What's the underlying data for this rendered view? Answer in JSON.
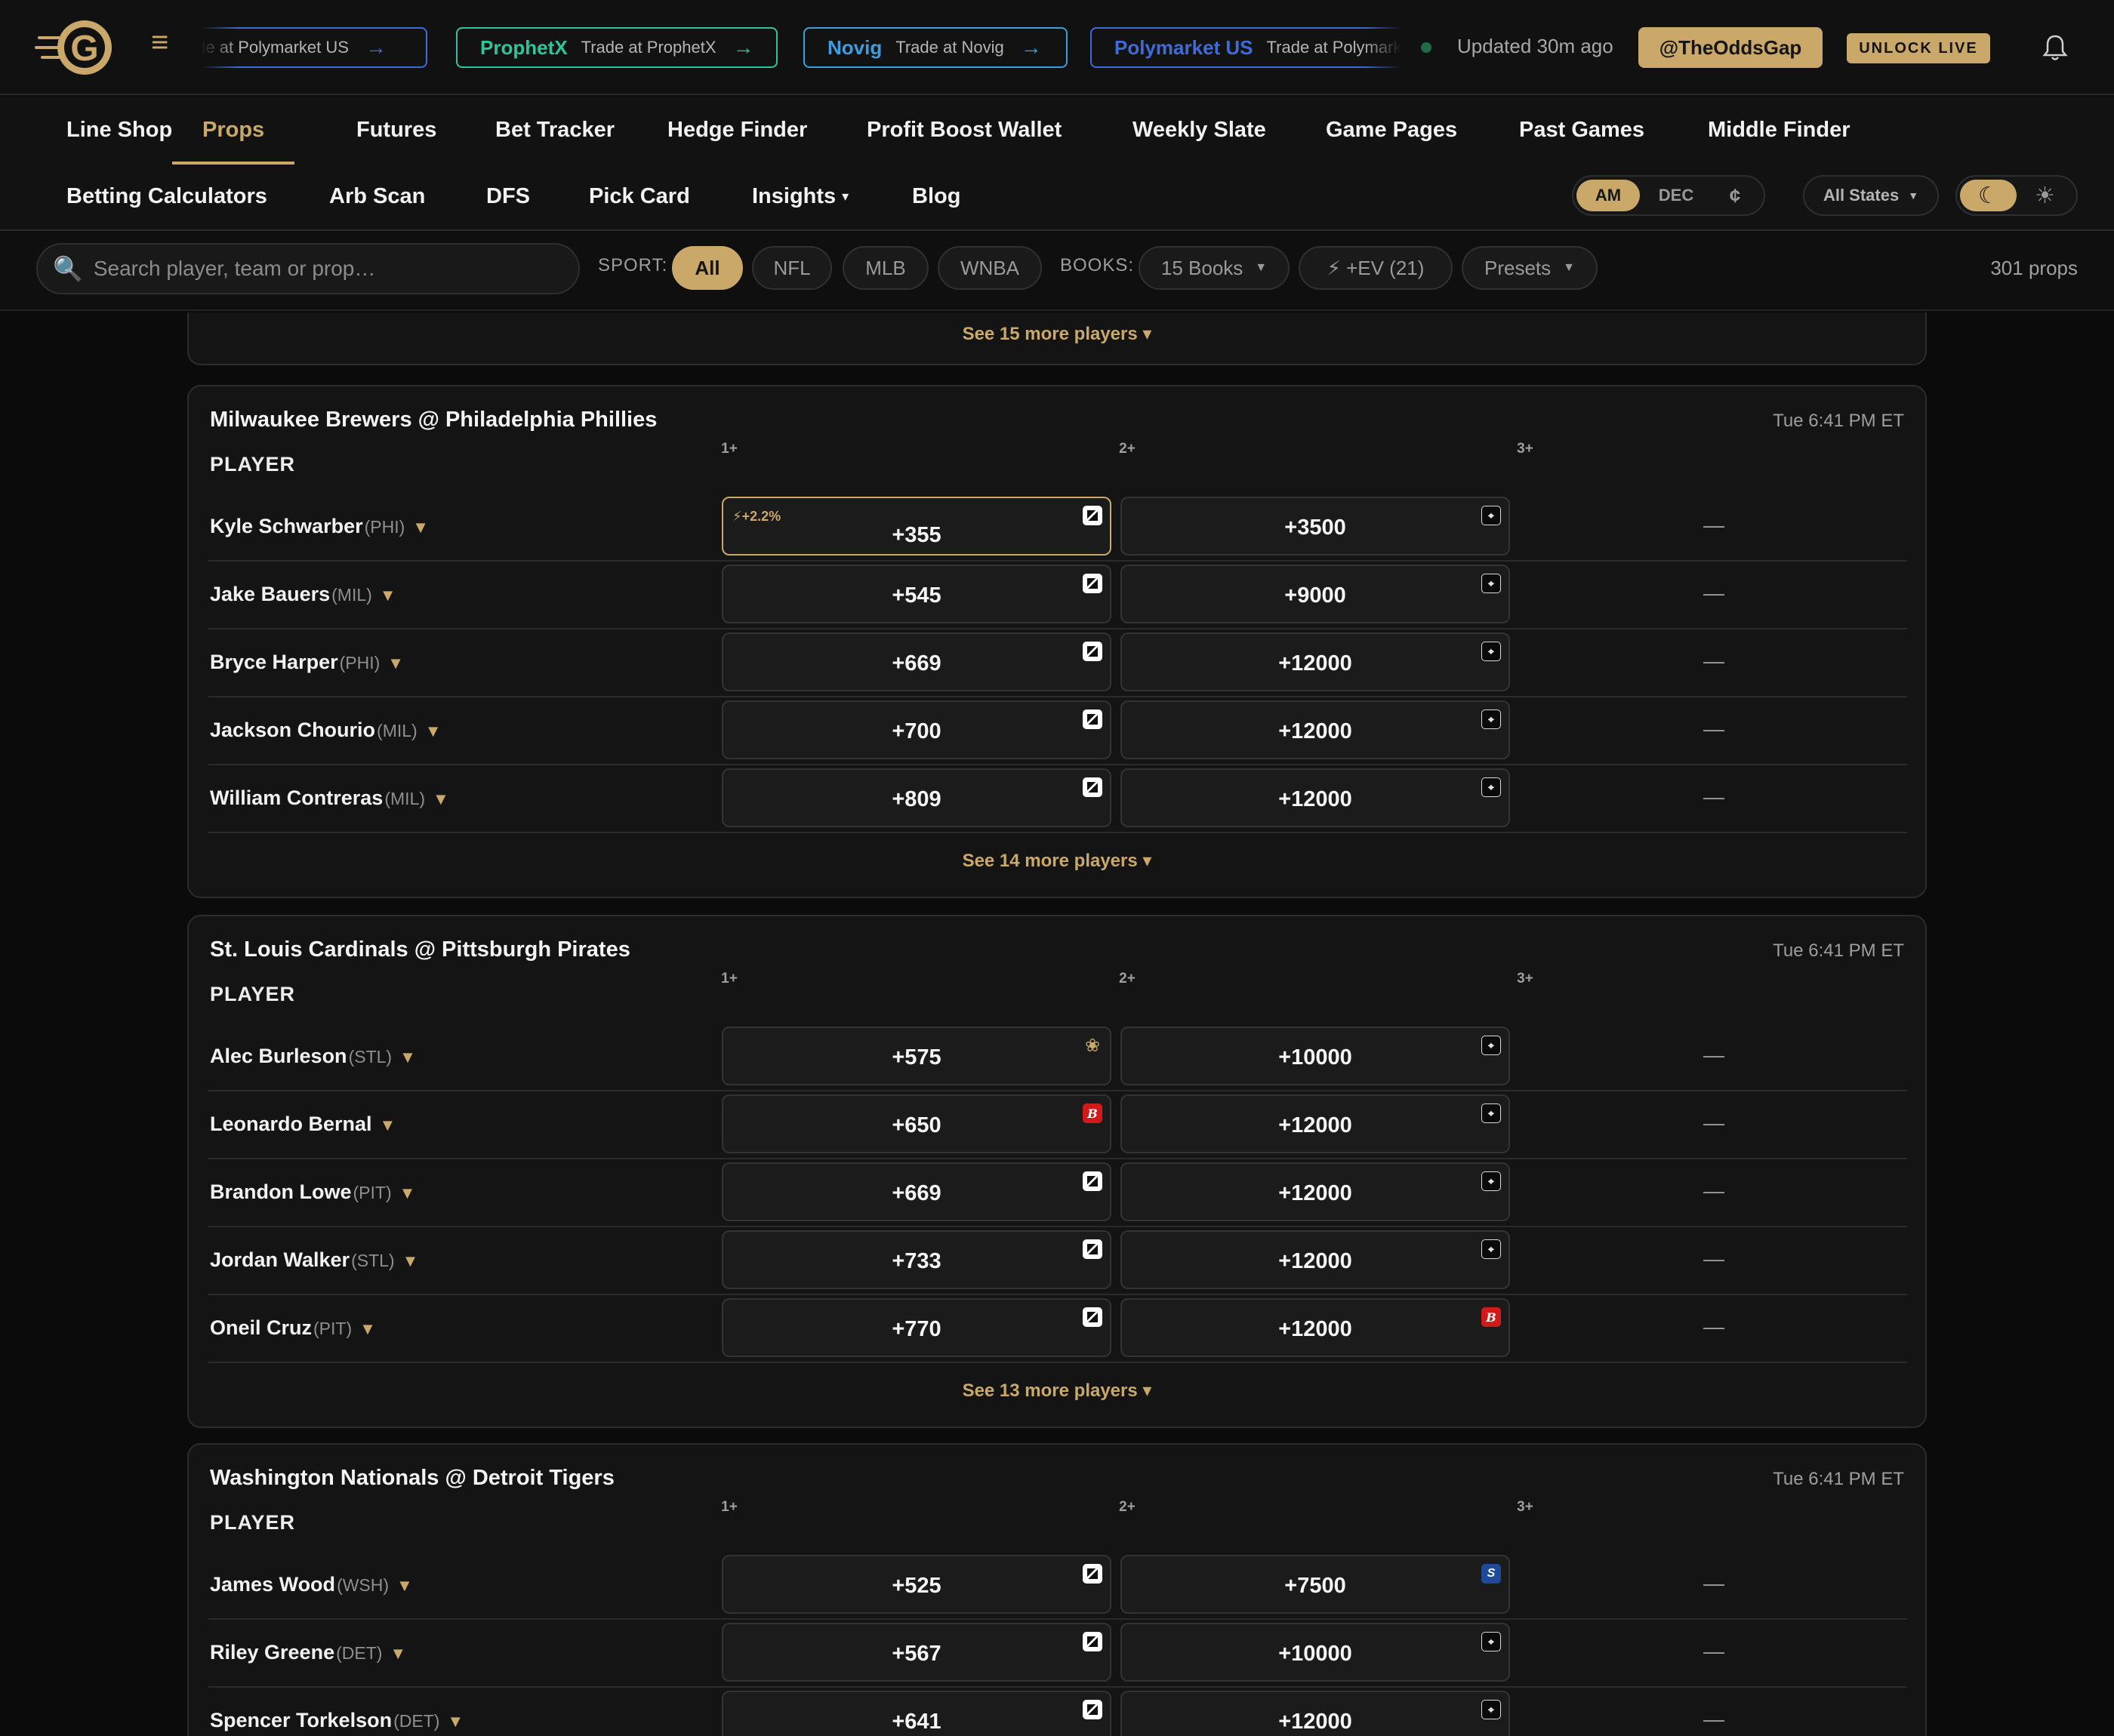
{
  "header": {
    "ticker": [
      {
        "name": "",
        "sub": "Trade at Polymarket US",
        "color": "#3f6bd8"
      },
      {
        "name": "ProphetX",
        "sub": "Trade at ProphetX",
        "color": "#2fc59a"
      },
      {
        "name": "Novig",
        "sub": "Trade at Novig",
        "color": "#3a9ee0"
      },
      {
        "name": "Polymarket US",
        "sub": "Trade at Polymarket US",
        "color": "#3f6bd8"
      }
    ],
    "ticker_arrow": "→",
    "updated": "Updated 30m ago",
    "handle": "@TheOddsGap",
    "unlock": "UNLOCK LIVE"
  },
  "nav": {
    "row1": [
      "Line Shop",
      "Props",
      "Futures",
      "Bet Tracker",
      "Hedge Finder",
      "Profit Boost Wallet",
      "Weekly Slate",
      "Game Pages",
      "Past Games",
      "Middle Finder"
    ],
    "row2": [
      "Betting Calculators",
      "Arb Scan",
      "DFS",
      "Pick Card",
      "Insights",
      "Blog"
    ],
    "active": "Props",
    "odds_format": [
      "AM",
      "DEC",
      "¢"
    ],
    "states": "All States",
    "theme": [
      "☾",
      "☀"
    ]
  },
  "filters": {
    "search_placeholder": "Search player, team or prop…",
    "sport_label": "SPORT:",
    "sports": [
      "All",
      "NFL",
      "MLB",
      "WNBA"
    ],
    "books_label": "BOOKS:",
    "books": "15 Books",
    "ev": "⚡ +EV (21)",
    "presets": "Presets",
    "count": "301 props"
  },
  "columns": [
    "1+",
    "2+",
    "3+"
  ],
  "player_label": "PLAYER",
  "top_see_more": "See 15 more players ▾",
  "games": [
    {
      "title": "Milwaukee Brewers @ Philadelphia Phillies",
      "time": "Tue 6:41 PM ET",
      "players": [
        {
          "name": "Kyle Schwarber",
          "team": "(PHI)",
          "o1": "+355",
          "b1": "nv",
          "o2": "+3500",
          "b2": "px",
          "ev": "⚡+2.2%"
        },
        {
          "name": "Jake Bauers",
          "team": "(MIL)",
          "o1": "+545",
          "b1": "nv",
          "o2": "+9000",
          "b2": "px"
        },
        {
          "name": "Bryce Harper",
          "team": "(PHI)",
          "o1": "+669",
          "b1": "nv",
          "o2": "+12000",
          "b2": "px"
        },
        {
          "name": "Jackson Chourio",
          "team": "(MIL)",
          "o1": "+700",
          "b1": "nv",
          "o2": "+12000",
          "b2": "px"
        },
        {
          "name": "William Contreras",
          "team": "(MIL)",
          "o1": "+809",
          "b1": "nv",
          "o2": "+12000",
          "b2": "px"
        }
      ],
      "see_more": "See 14 more players ▾"
    },
    {
      "title": "St. Louis Cardinals @ Pittsburgh Pirates",
      "time": "Tue 6:41 PM ET",
      "players": [
        {
          "name": "Alec Burleson",
          "team": "(STL)",
          "o1": "+575",
          "b1": "fl",
          "o2": "+10000",
          "b2": "px"
        },
        {
          "name": "Leonardo Bernal",
          "team": "",
          "o1": "+650",
          "b1": "bm",
          "o2": "+12000",
          "b2": "px"
        },
        {
          "name": "Brandon Lowe",
          "team": "(PIT)",
          "o1": "+669",
          "b1": "nv",
          "o2": "+12000",
          "b2": "px"
        },
        {
          "name": "Jordan Walker",
          "team": "(STL)",
          "o1": "+733",
          "b1": "nv",
          "o2": "+12000",
          "b2": "px"
        },
        {
          "name": "Oneil Cruz",
          "team": "(PIT)",
          "o1": "+770",
          "b1": "nv",
          "o2": "+12000",
          "b2": "bm"
        }
      ],
      "see_more": "See 13 more players ▾"
    },
    {
      "title": "Washington Nationals @ Detroit Tigers",
      "time": "Tue 6:41 PM ET",
      "players": [
        {
          "name": "James Wood",
          "team": "(WSH)",
          "o1": "+525",
          "b1": "nv",
          "o2": "+7500",
          "b2": "st"
        },
        {
          "name": "Riley Greene",
          "team": "(DET)",
          "o1": "+567",
          "b1": "nv",
          "o2": "+10000",
          "b2": "px"
        },
        {
          "name": "Spencer Torkelson",
          "team": "(DET)",
          "o1": "+641",
          "b1": "nv",
          "o2": "+12000",
          "b2": "px"
        }
      ],
      "see_more": ""
    }
  ],
  "no_odds": "—",
  "colors": {
    "accent": "#c9a86a",
    "background": "#0b0b0b",
    "card": "#141414"
  }
}
